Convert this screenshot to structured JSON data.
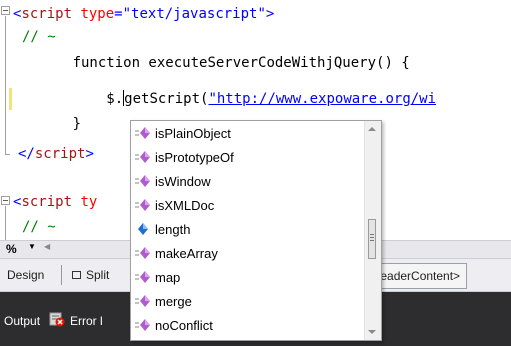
{
  "editor": {
    "lines": [
      {
        "open": "<",
        "tag": "script",
        "attr": "type",
        "eq": "=",
        "value": "\"text/javascript\"",
        "close": ">"
      },
      {
        "comment": "// ~"
      },
      {
        "indent": "      ",
        "code": "function executeServerCodeWithjQuery() {"
      },
      {
        "indent": "          ",
        "pre": "$.",
        "post": "getScript(",
        "url": "\"http://www.expoware.org/wi"
      },
      {
        "indent": "      ",
        "code": "}"
      },
      {
        "open": "</",
        "tag": "script",
        "close": ">"
      },
      {
        "open": "<",
        "tag": "script",
        "attr_partial": "ty"
      },
      {
        "comment": "// ~"
      }
    ]
  },
  "intellisense": {
    "items": [
      {
        "label": "isPlainObject",
        "icon": "method-icon"
      },
      {
        "label": "isPrototypeOf",
        "icon": "method-icon"
      },
      {
        "label": "isWindow",
        "icon": "method-icon"
      },
      {
        "label": "isXMLDoc",
        "icon": "method-icon"
      },
      {
        "label": "length",
        "icon": "property-icon"
      },
      {
        "label": "makeArray",
        "icon": "method-icon"
      },
      {
        "label": "map",
        "icon": "method-icon"
      },
      {
        "label": "merge",
        "icon": "method-icon"
      },
      {
        "label": "noConflict",
        "icon": "method-icon"
      }
    ]
  },
  "toolbar": {
    "zoom": "%",
    "design_label": "Design",
    "split_label": "Split",
    "breadcrumb": "#HeaderContent>"
  },
  "statusbar": {
    "output_label": "Output",
    "error_label": "Error l"
  },
  "colors": {
    "tag": "#a31515",
    "attribute": "#ff0000",
    "string": "#0000ff",
    "comment": "#008000",
    "method_icon": "#b05ccf",
    "property_icon": "#1e6fd0",
    "statusbar_bg": "#2d2d30"
  }
}
